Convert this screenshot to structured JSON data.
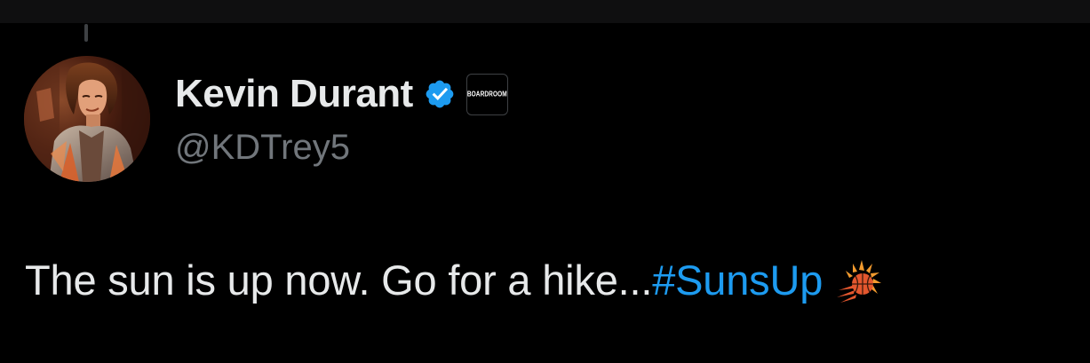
{
  "tweet": {
    "author": {
      "display_name": "Kevin Durant",
      "handle": "@KDTrey5",
      "verified_icon": "verified-badge-icon",
      "affiliate_badge": "BOARDROOM",
      "avatar": "profile-avatar"
    },
    "text": {
      "body": "The sun is up now. Go for a hike...",
      "hashtag": "#SunsUp",
      "emoji": "suns-logo-icon"
    }
  },
  "colors": {
    "background": "#000000",
    "text_primary": "#e7e9ea",
    "text_secondary": "#71767b",
    "link": "#1d9bf0",
    "verified": "#1d9bf0"
  }
}
